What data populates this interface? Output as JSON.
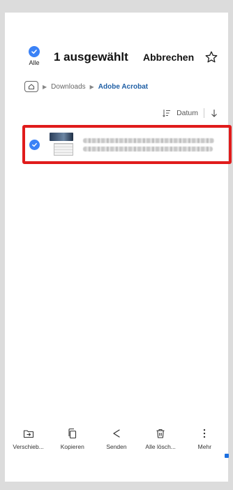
{
  "header": {
    "select_all_label": "Alle",
    "selected_title": "1 ausgewählt",
    "cancel_label": "Abbrechen"
  },
  "breadcrumb": {
    "folder": "Downloads",
    "current": "Adobe Acrobat"
  },
  "sort": {
    "label": "Datum"
  },
  "file": {
    "selected": true
  },
  "actions": [
    {
      "label": "Verschieb...",
      "icon": "move-icon"
    },
    {
      "label": "Kopieren",
      "icon": "copy-icon"
    },
    {
      "label": "Senden",
      "icon": "share-icon"
    },
    {
      "label": "Alle lösch...",
      "icon": "delete-icon"
    },
    {
      "label": "Mehr",
      "icon": "more-icon"
    }
  ],
  "colors": {
    "accent": "#3b82f6",
    "highlight": "#e01b1b",
    "link": "#1f5fa5"
  }
}
